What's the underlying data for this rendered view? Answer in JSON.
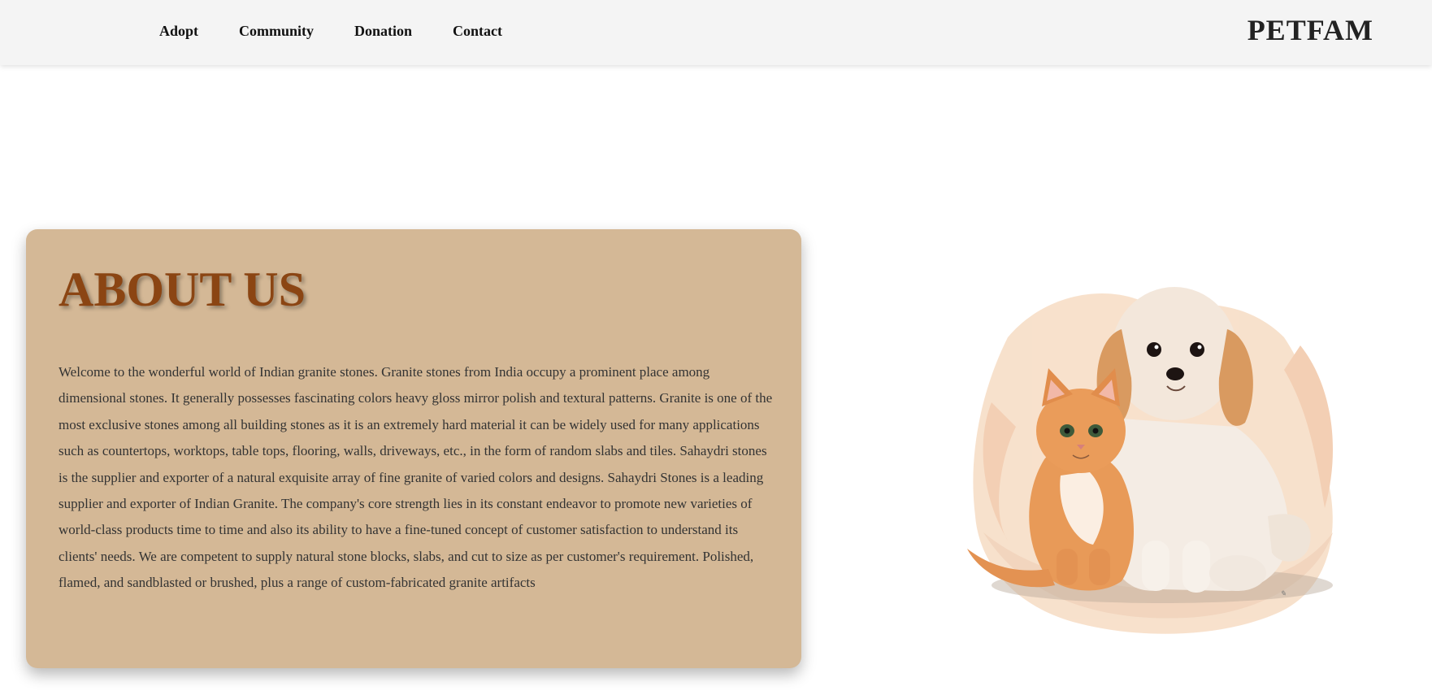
{
  "nav": {
    "links": [
      "Adopt",
      "Community",
      "Donation",
      "Contact"
    ],
    "brand": "PETFAM"
  },
  "about": {
    "title": "ABOUT US",
    "body": "Welcome to the wonderful world of Indian granite stones. Granite stones from India occupy a prominent place among dimensional stones. It generally possesses fascinating colors heavy gloss mirror polish and textural patterns. Granite is one of the most exclusive stones among all building stones as it is an extremely hard material it can be widely used for many applications such as countertops, worktops, table tops, flooring, walls, driveways, etc., in the form of random slabs and tiles. Sahaydri stones is the supplier and exporter of a natural exquisite array of fine granite of varied colors and designs. Sahaydri Stones is a leading supplier and exporter of Indian Granite. The company's core strength lies in its constant endeavor to promote new varieties of world-class products time to time and also its ability to have a fine-tuned concept of customer satisfaction to understand its clients' needs. We are competent to supply natural stone blocks, slabs, and cut to size as per customer's requirement. Polished, flamed, and sandblasted or brushed, plus a range of custom-fabricated granite artifacts"
  },
  "colors": {
    "navbar_bg": "#f4f4f4",
    "card_bg": "#d4b896",
    "title_color": "#8b4513",
    "body_text": "#333333"
  },
  "illustration": {
    "icon": "puppy-and-kitten-illustration"
  }
}
